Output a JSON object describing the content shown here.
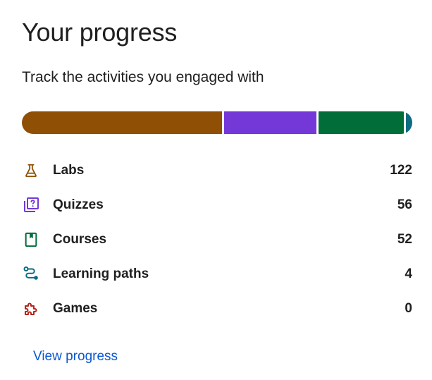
{
  "header": {
    "title": "Your progress",
    "subtitle": "Track the activities you engaged with"
  },
  "progress_bar": {
    "segments": [
      {
        "name": "Labs",
        "value": 122,
        "color": "#8f4f04"
      },
      {
        "name": "Quizzes",
        "value": 56,
        "color": "#7438d8"
      },
      {
        "name": "Courses",
        "value": 52,
        "color": "#016e3a"
      },
      {
        "name": "Learning paths",
        "value": 4,
        "color": "#0d6b82"
      }
    ]
  },
  "activities": [
    {
      "label": "Labs",
      "count": "122",
      "icon": "flask-icon",
      "color": "#8f4f04"
    },
    {
      "label": "Quizzes",
      "count": "56",
      "icon": "quiz-icon",
      "color": "#7438d8"
    },
    {
      "label": "Courses",
      "count": "52",
      "icon": "book-icon",
      "color": "#016e3a"
    },
    {
      "label": "Learning paths",
      "count": "4",
      "icon": "route-icon",
      "color": "#0d6b82"
    },
    {
      "label": "Games",
      "count": "0",
      "icon": "puzzle-icon",
      "color": "#b3261e"
    }
  ],
  "footer": {
    "link_label": "View progress"
  }
}
